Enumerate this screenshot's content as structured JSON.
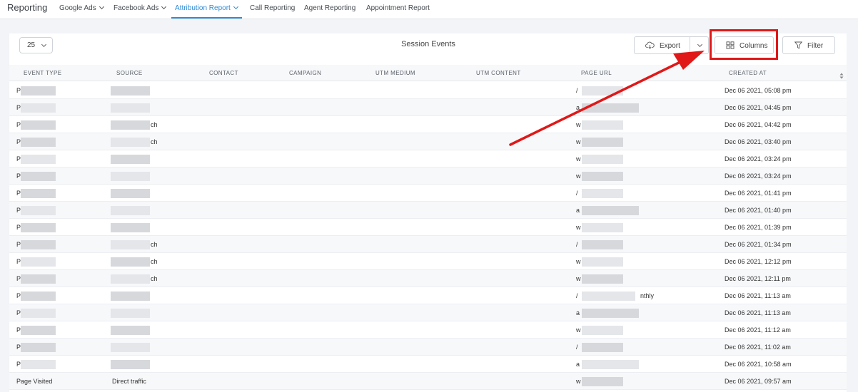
{
  "topnav": {
    "brand": "Reporting",
    "items": [
      {
        "label": "Google Ads",
        "has_caret": true
      },
      {
        "label": "Facebook Ads",
        "has_caret": true
      },
      {
        "label": "Attribution Report",
        "has_caret": true,
        "active": true
      },
      {
        "label": "Call Reporting",
        "has_caret": false
      },
      {
        "label": "Agent Reporting",
        "has_caret": false
      },
      {
        "label": "Appointment Report",
        "has_caret": false
      }
    ]
  },
  "toolbar": {
    "page_size": "25",
    "title": "Session Events",
    "export_label": "Export",
    "columns_label": "Columns",
    "filter_label": "Filter"
  },
  "table": {
    "headers": [
      "EVENT TYPE",
      "SOURCE",
      "CONTACT",
      "CAMPAIGN",
      "UTM MEDIUM",
      "UTM CONTENT",
      "PAGE URL",
      "CREATED AT"
    ],
    "rows": [
      {
        "event_type": "P",
        "source": "",
        "page_url": "/",
        "created_at": "Dec 06 2021, 05:08 pm"
      },
      {
        "event_type": "P",
        "source": "",
        "page_url": "a",
        "created_at": "Dec 06 2021, 04:45 pm"
      },
      {
        "event_type": "P",
        "source": "ch",
        "page_url": "w",
        "created_at": "Dec 06 2021, 04:42 pm"
      },
      {
        "event_type": "P",
        "source": "ch",
        "page_url": "w",
        "created_at": "Dec 06 2021, 03:40 pm"
      },
      {
        "event_type": "P",
        "source": "",
        "page_url": "w",
        "created_at": "Dec 06 2021, 03:24 pm"
      },
      {
        "event_type": "P",
        "source": "",
        "page_url": "w",
        "created_at": "Dec 06 2021, 03:24 pm"
      },
      {
        "event_type": "P",
        "source": "",
        "page_url": "/",
        "created_at": "Dec 06 2021, 01:41 pm"
      },
      {
        "event_type": "P",
        "source": "",
        "page_url": "a",
        "created_at": "Dec 06 2021, 01:40 pm"
      },
      {
        "event_type": "P",
        "source": "",
        "page_url": "w",
        "created_at": "Dec 06 2021, 01:39 pm"
      },
      {
        "event_type": "P",
        "source": "ch",
        "page_url": "/",
        "created_at": "Dec 06 2021, 01:34 pm"
      },
      {
        "event_type": "P",
        "source": "ch",
        "page_url": "w",
        "created_at": "Dec 06 2021, 12:12 pm"
      },
      {
        "event_type": "P",
        "source": "ch",
        "page_url": "w",
        "created_at": "Dec 06 2021, 12:11 pm"
      },
      {
        "event_type": "P",
        "source": "",
        "page_url": "/",
        "page_url_tail": "nthly",
        "created_at": "Dec 06 2021, 11:13 am"
      },
      {
        "event_type": "P",
        "source": "",
        "page_url": "a",
        "created_at": "Dec 06 2021, 11:13 am"
      },
      {
        "event_type": "P",
        "source": "",
        "page_url": "w",
        "created_at": "Dec 06 2021, 11:12 am"
      },
      {
        "event_type": "P",
        "source": "",
        "page_url": "/",
        "created_at": "Dec 06 2021, 11:02 am"
      },
      {
        "event_type": "P",
        "source": "",
        "page_url": "a",
        "created_at": "Dec 06 2021, 10:58 am"
      },
      {
        "event_type": "Page Visited",
        "source": "Direct traffic",
        "page_url": "w",
        "created_at": "Dec 06 2021, 09:57 am"
      }
    ]
  },
  "colors": {
    "accent": "#2f8bd6",
    "annotation_red": "#e01818",
    "row_alt": "#f7f8fa"
  },
  "icons": [
    "cloud-download-icon",
    "chevron-down-icon",
    "columns-grid-icon",
    "filter-funnel-icon",
    "sort-arrows-icon"
  ]
}
